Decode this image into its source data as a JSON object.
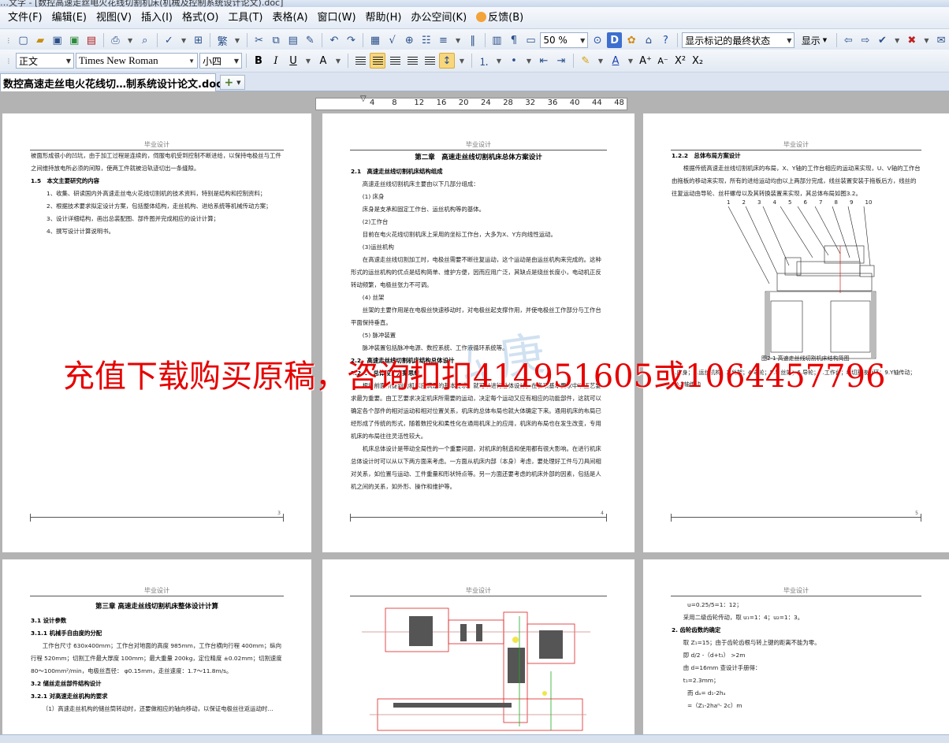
{
  "titlebar": {
    "text": "…文字 - [数控高速走丝电火花线切割机床(机械及控制系统设计论文).doc]"
  },
  "menu": [
    "文件(F)",
    "编辑(E)",
    "视图(V)",
    "插入(I)",
    "格式(O)",
    "工具(T)",
    "表格(A)",
    "窗口(W)",
    "帮助(H)",
    "办公空间(K)",
    "反馈(B)"
  ],
  "toolbar1": {
    "zoom": "50 %",
    "track_mode": "显示标记的最终状态",
    "show_label": "显示"
  },
  "toolbar2": {
    "style": "正文",
    "font": "Times New Roman",
    "size": "小四"
  },
  "tab": {
    "title": "数控高速走丝电火花线切…制系统设计论文.doc",
    "close": "×",
    "new": "+"
  },
  "ruler": {
    "ticks": [
      "4",
      "8",
      "12",
      "16",
      "20",
      "24",
      "28",
      "32",
      "36",
      "40",
      "44",
      "48"
    ]
  },
  "watermark": "充值下载购买原稿，咨询扣扣414951605或1064457796",
  "page_header": "毕业设计",
  "pages": [
    {
      "lines": [
        {
          "t": "被面形成很小的凹坑，由于加工过程是连续的，伺服电机受到控制不断进给，以保持电极丝与工件之间维持放电所必须的间隙，使两工件就被沿轨迹切出一条缝隙。",
          "c": "ni"
        },
        {
          "t": "1.5　本文主要研究的内容",
          "c": "sec"
        },
        {
          "t": "1、收集、研读国内外高速走丝电火花线切割机的技术资料，特别是结构和控制资料；",
          "c": "ind"
        },
        {
          "t": "2、根据技术要求拟定设计方案，包括整体结构，走丝机构、进给系统等机械传动方案；",
          "c": "ind"
        },
        {
          "t": "3、设计详细结构，画出总装配图、部件图并完成相应的设计计算；",
          "c": "ind"
        },
        {
          "t": "4、撰写设计计算说明书。",
          "c": "ind"
        }
      ],
      "footer": "3"
    },
    {
      "lines": [
        {
          "t": "第二章　高速走丝线切割机床总体方案设计",
          "c": "chap"
        },
        {
          "t": "2.1　高速走丝线切割机床结构组成",
          "c": "sec"
        },
        {
          "t": "高速走丝线切割机床主要由以下几部分组成：",
          "c": ""
        },
        {
          "t": "(1) 床身",
          "c": ""
        },
        {
          "t": "床身是支承和固定工作台、运丝机构等的基体。",
          "c": ""
        },
        {
          "t": "(2)工作台",
          "c": ""
        },
        {
          "t": "目前在电火花线切割机床上采用的坐标工作台，大多为X、Y方向线性运动。",
          "c": ""
        },
        {
          "t": "(3)运丝机构",
          "c": ""
        },
        {
          "t": "在高速走丝线切割加工时，电极丝需要不断往复运动，这个运动是由运丝机构来完成的。这种形式的运丝机构的优点是结构简单、维护方便，因而应用广泛，其缺点是绕丝长度小，电动机正反转动频繁，电极丝张力不可调。",
          "c": ""
        },
        {
          "t": "(4) 丝架",
          "c": ""
        },
        {
          "t": "丝架的主要作用是在电极丝快速移动时，对电极丝起支撑作用，并使电极丝工作部分与工作台平面保持垂直。",
          "c": ""
        },
        {
          "t": "(5) 脉冲装置",
          "c": ""
        },
        {
          "t": "脉冲装置包括脉冲电源、数控系统、工作液循环系统等。",
          "c": ""
        },
        {
          "t": "2.2　高速走丝线切割机床结构总体设计",
          "c": "sec"
        },
        {
          "t": "2.2.1　总体设计方案思想",
          "c": "sec"
        },
        {
          "t": "根据前面所提到的机床应满足的基本要求，就可以进行总体设计。在各项基本要求中以工艺要求最为重要。由工艺要求决定机床所需要的运动，决定每个运动又应有相应的功能部件，这就可以确定各个部件的相对运动和相对位置关系，机床的总体布局也就大体确定下来。通用机床的布局已经形成了传统的形式，随着数控化和柔性化在通用机床上的应用，机床的布局也在发生改变，专用机床的布局往往灵活性较大。",
          "c": ""
        },
        {
          "t": "机床总体设计是带动全局性的一个重要问题，对机床的制造和使用都有很大影响。在进行机床总体设计时可以从以下两方面来考虑。一方面从机床内部（本身）考虑，要处理好工件与刀具间相对关系，如位置与运动、工件重量和形状特点等。另一方面还要考虑的机床外部的因素，包括是人机之间的关系，如外形、操作和维护等。",
          "c": ""
        }
      ],
      "footer": "4"
    },
    {
      "lines": [
        {
          "t": "1.2.2　总体布局方案设计",
          "c": "sec"
        },
        {
          "t": "根据传统高速走丝线切割机床的布局，X、Y轴的工作台相应的运动来实现，U、V轴的工作台由拖板的移动来实现，所有的进给运动均由以上两部分完成，线丝装置安装于拖板后方，线丝的往复运动由导轮、丝杆螺母以及其转换装置来实现，其总体布局如图3.2。",
          "c": ""
        }
      ],
      "figure_numbers": [
        "1",
        "2",
        "3",
        "4",
        "5",
        "6",
        "7",
        "8",
        "9",
        "10"
      ],
      "caption": "图2-1 高速走丝线切割机床结构简图",
      "legend": "1.床身；2.运丝机构；3.丝架；4.导轮；5.导丝架；6.导轮；7.工作台；8.切割液循环；9.Y轴传动；10.X轴传动",
      "footer": "5"
    },
    {
      "lines": [
        {
          "t": "第三章 高速走丝线切割机床整体设计计算",
          "c": "chap"
        },
        {
          "t": "3.1 设计参数",
          "c": "sec"
        },
        {
          "t": "3.1.1 机械手自由度的分配",
          "c": "sec"
        },
        {
          "t": "工作台尺寸 630x400mm；工作台对地面的高度 985mm，工作台横向行程 400mm；纵向行程 520mm；切割工件最大厚度 100mm；最大重量 200kg，定位精度 ±0.02mm；切割速度 80～100mm²/min，电极丝直径： φ0.15mm，走丝速度：1.7～11.8m/s。",
          "c": ""
        },
        {
          "t": "3.2 储丝走丝部件结构设计",
          "c": "sec"
        },
        {
          "t": "3.2.1 对高速走丝机构的要求",
          "c": "sec"
        },
        {
          "t": "（1）高速走丝机构的储丝筒转动时，还要做相应的轴向移动，以保证电极丝往返运动时…",
          "c": ""
        }
      ]
    },
    {
      "lines": []
    },
    {
      "lines": [
        {
          "t": "u=0.25/5=1：12；",
          "c": "ind"
        },
        {
          "t": "采用二级齿轮传动，取 u₁=1：4；u₂=1：3。",
          "c": ""
        },
        {
          "t": "2. 齿轮齿数的确定",
          "c": "sec"
        },
        {
          "t": "取 Z₁=15；由于齿轮齿根与转上键的距离不能为零。",
          "c": ""
        },
        {
          "t": "即 d/2 -（d+t₁） >2m",
          "c": ""
        },
        {
          "t": "由 d=16mm 查设计手册得：",
          "c": ""
        },
        {
          "t": "t₁=2.3mm；",
          "c": ""
        },
        {
          "t": "而 dₐ= d₁-2hₐ",
          "c": "ind"
        },
        {
          "t": "=（Z₁-2haⁿ- 2c）m",
          "c": "ind"
        }
      ]
    }
  ],
  "colors": {
    "watermark": "#e60000",
    "menubar": "#eef3f9",
    "workspace": "#b3b3b3"
  }
}
